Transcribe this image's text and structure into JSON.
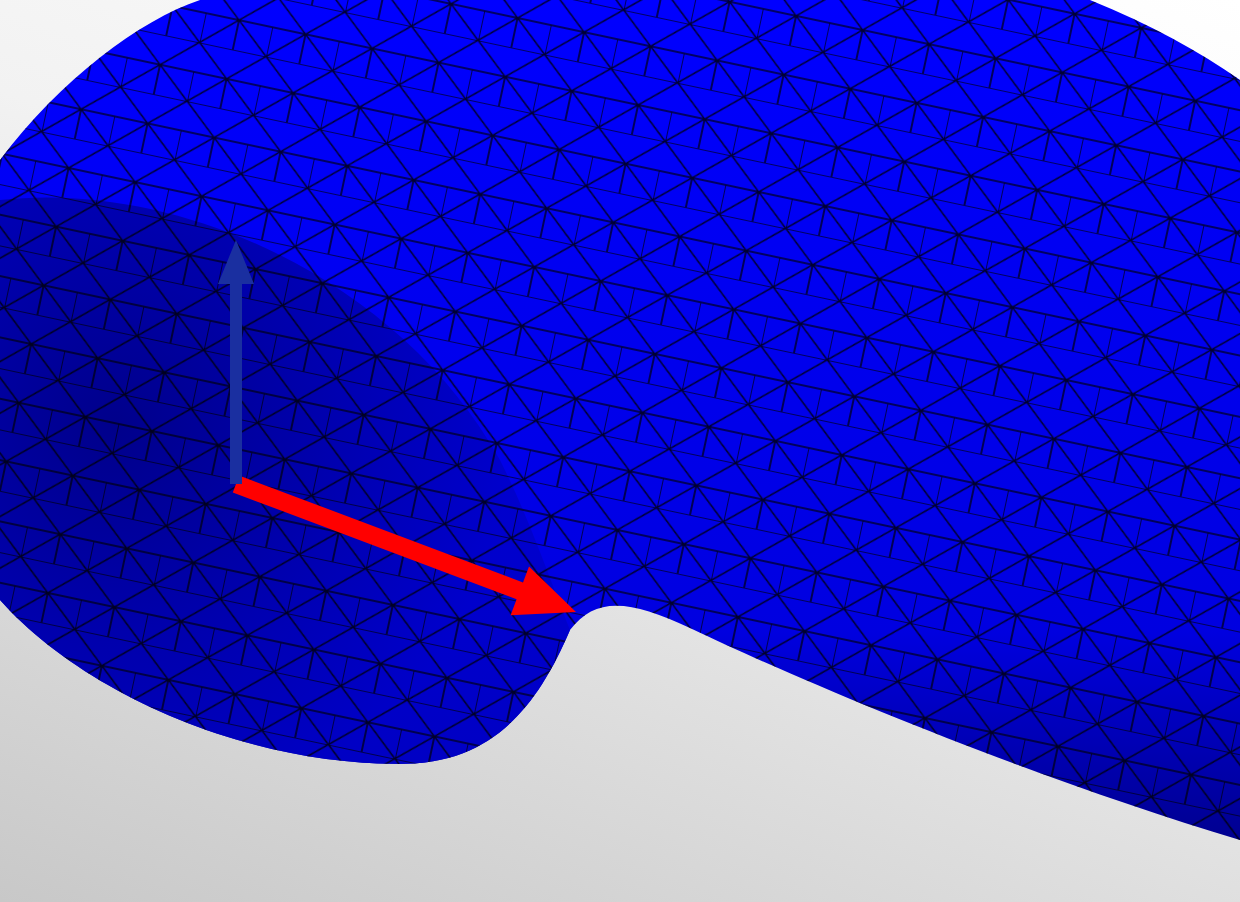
{
  "viewport": {
    "arrows": [
      {
        "kind": "direction",
        "color": "#ff0000"
      },
      {
        "kind": "normal",
        "color": "#1a2fa0"
      }
    ]
  }
}
